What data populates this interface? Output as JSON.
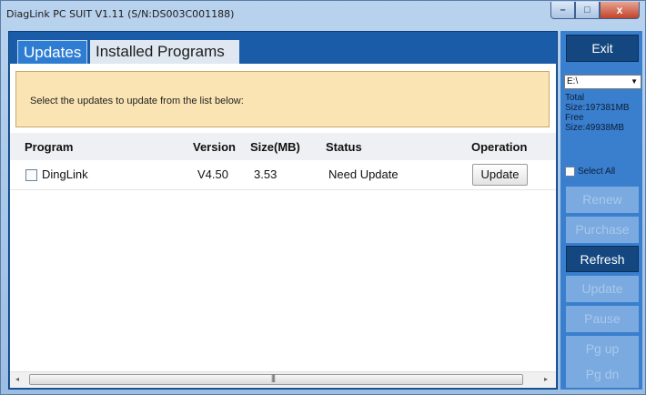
{
  "window": {
    "title": "DiagLink PC SUIT V1.11  (S/N:DS003C001188)",
    "controls": {
      "minimize": "–",
      "maximize": "□",
      "close": "x"
    }
  },
  "tabs": [
    {
      "label": "Updates",
      "active": true
    },
    {
      "label": "Installed Programs",
      "active": false
    }
  ],
  "notice": "Select the updates to update from the list below:",
  "table": {
    "columns": [
      "Program",
      "Version",
      "Size(MB)",
      "Status",
      "Operation"
    ],
    "rows": [
      {
        "program": "DingLink",
        "version": "V4.50",
        "size": "3.53",
        "status": "Need Update",
        "operation": "Update",
        "checked": false
      }
    ]
  },
  "scrollbar": {
    "left_arrow": "◂",
    "right_arrow": "▸",
    "grip": "|||"
  },
  "sidebar": {
    "exit_label": "Exit",
    "drive": "E:\\",
    "total_label": "Total",
    "total_size": "Size:197381MB",
    "free_label": "Free",
    "free_size": "Size:49938MB",
    "select_all_label": "Select All",
    "buttons": [
      {
        "label": "Renew",
        "enabled": false
      },
      {
        "label": "Purchase",
        "enabled": false
      },
      {
        "label": "Refresh",
        "enabled": true
      },
      {
        "label": "Update",
        "enabled": false
      },
      {
        "label": "Pause",
        "enabled": false
      },
      {
        "label": "Pg up",
        "enabled": false
      },
      {
        "label": "Pg dn",
        "enabled": false
      }
    ]
  },
  "colors": {
    "tab_active": "#2f7dd3",
    "panel_blue": "#1a5ca8",
    "sidebar_blue": "#3a7fce",
    "button_dark": "#14477f",
    "button_disabled": "#7aaae0",
    "notice_bg": "#fbe4b3"
  }
}
